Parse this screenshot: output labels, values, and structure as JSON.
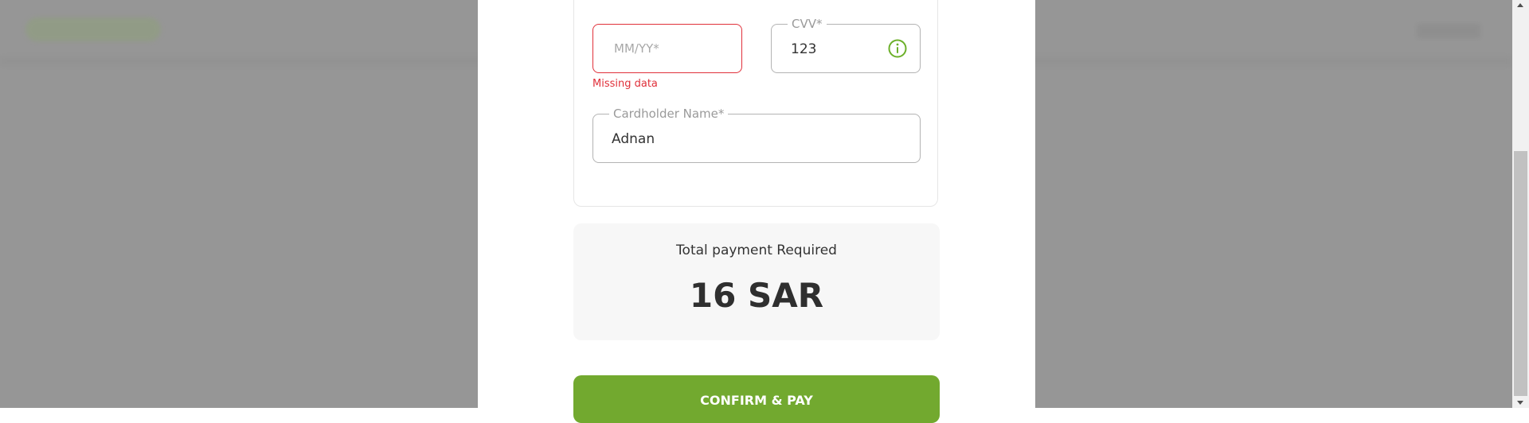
{
  "payment_form": {
    "expiry": {
      "placeholder": "MM/YY*",
      "value": "",
      "error": "Missing data"
    },
    "cvv": {
      "label": "CVV*",
      "value": "123",
      "status_icon": "info-circle-icon"
    },
    "cardholder": {
      "label": "Cardholder Name*",
      "value": "Adnan"
    }
  },
  "summary": {
    "label": "Total payment Required",
    "amount": "16 SAR"
  },
  "actions": {
    "confirm_label": "CONFIRM & PAY"
  },
  "colors": {
    "accent": "#72a92f",
    "error": "#e0303a",
    "success_icon": "#6cb02a",
    "overlay": "#969696"
  }
}
